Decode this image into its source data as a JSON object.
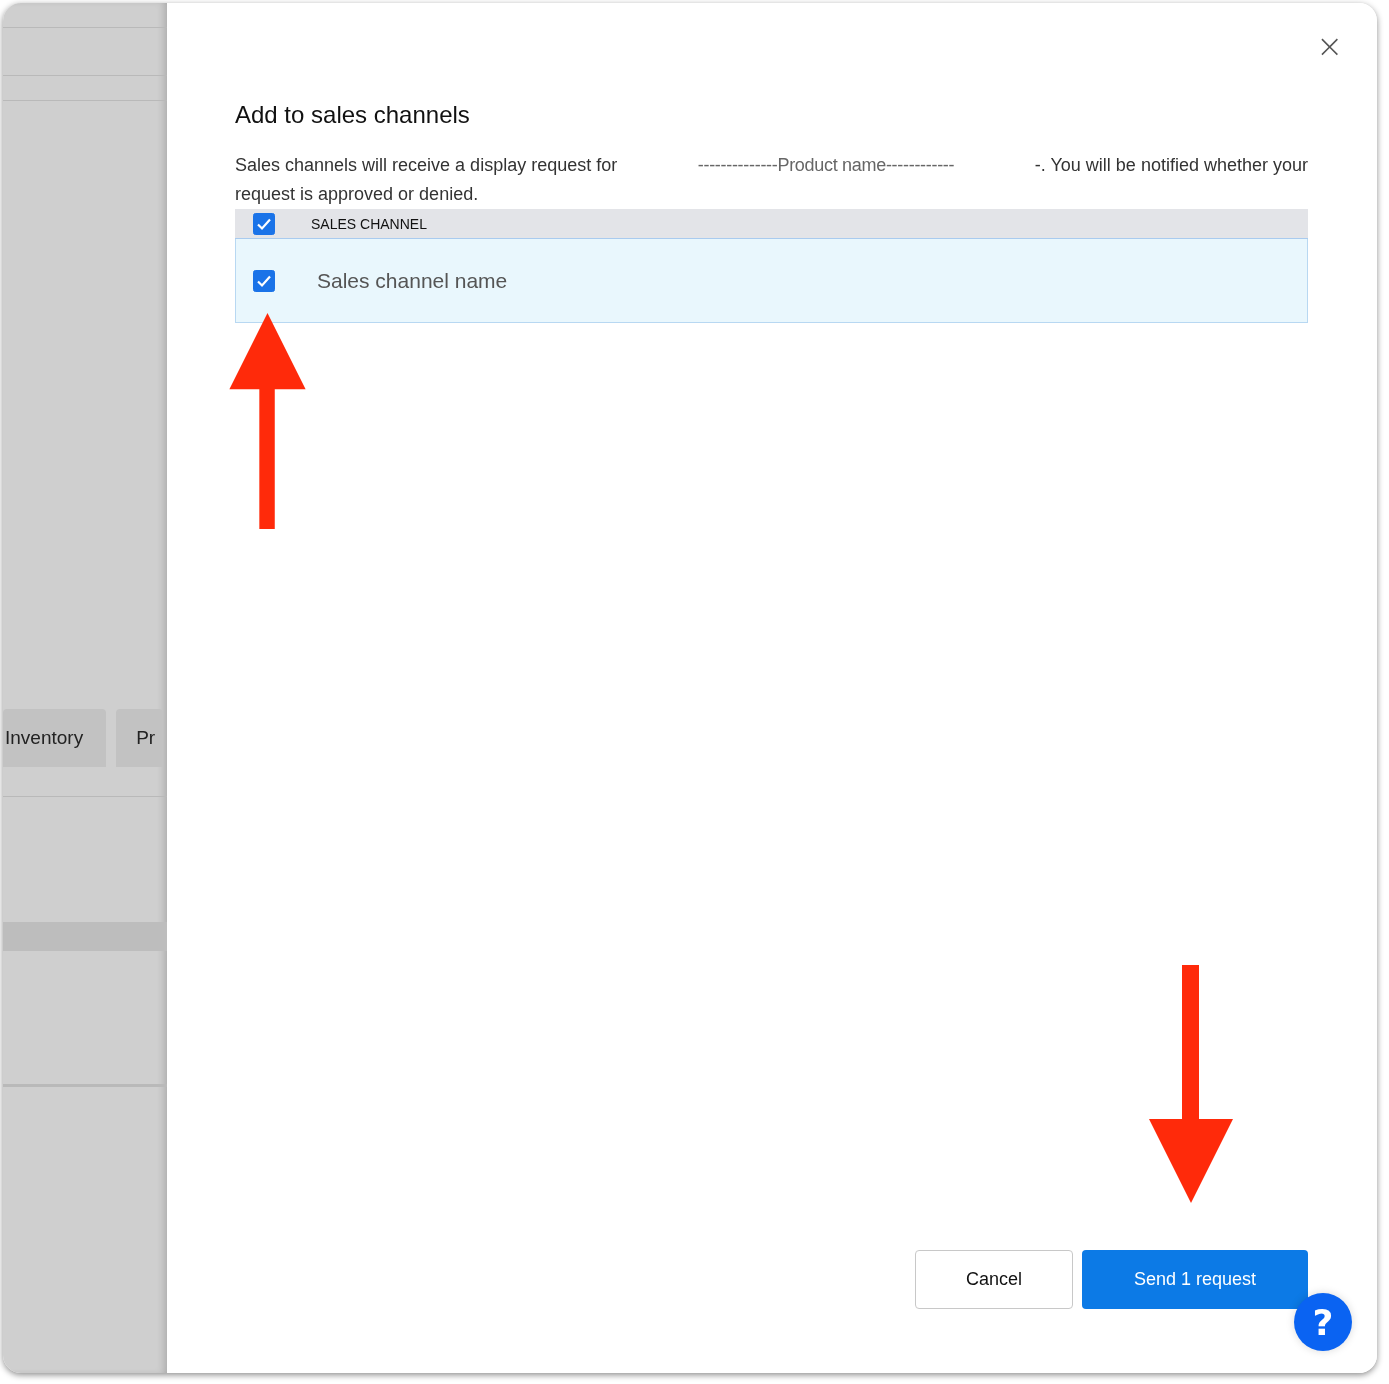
{
  "background": {
    "tabs": [
      {
        "label": "Inventory"
      },
      {
        "label": "Pr"
      }
    ]
  },
  "dialog": {
    "title": "Add to sales channels",
    "close": "×",
    "description": {
      "start": "Sales channels will receive a display request for",
      "product": "--------------Product name------------",
      "end": "-. You will be notified whether your",
      "line_2": "request is approved or denied."
    },
    "table": {
      "header": {
        "label": "SALES CHANNEL",
        "checked": true
      },
      "rows": [
        {
          "name": "Sales channel name",
          "checked": true,
          "selected": true
        }
      ]
    },
    "buttons": [
      {
        "kind": "secondary",
        "label": "Cancel"
      },
      {
        "kind": "primary",
        "label": "Send 1 request"
      }
    ]
  },
  "help": {
    "label": "?"
  },
  "annotations": [
    {
      "kind": "arrow-up"
    },
    {
      "kind": "arrow-down"
    }
  ]
}
